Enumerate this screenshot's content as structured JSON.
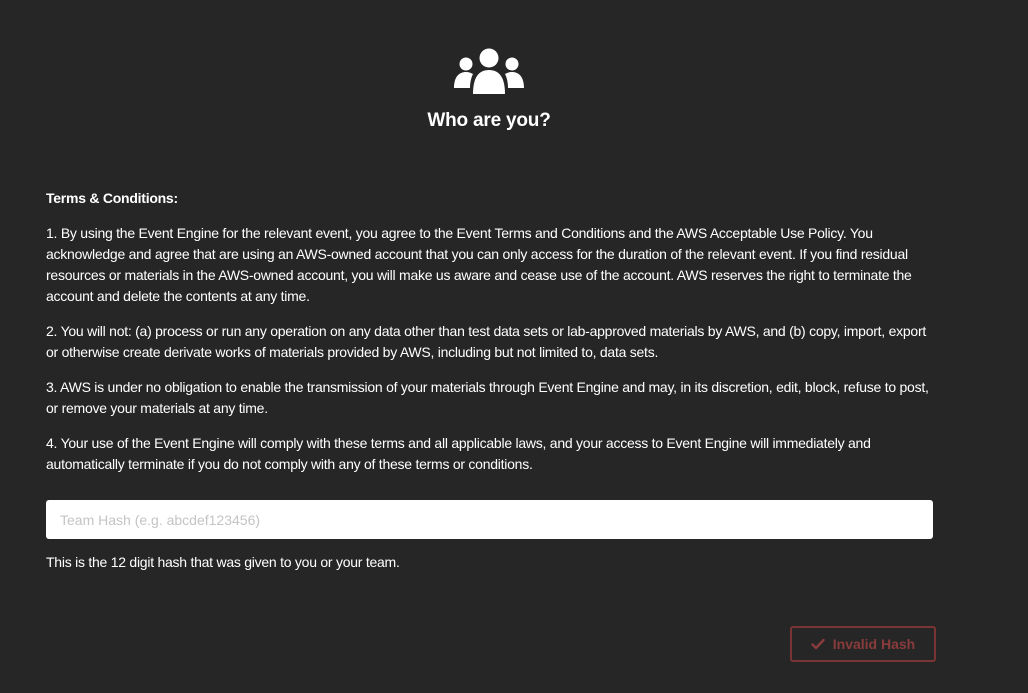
{
  "header": {
    "icon": "users-icon",
    "title": "Who are you?"
  },
  "terms": {
    "heading": "Terms & Conditions:",
    "items": [
      "1. By using the Event Engine for the relevant event, you agree to the Event Terms and Conditions and the AWS Acceptable Use Policy. You acknowledge and agree that are using an AWS-owned account that you can only access for the duration of the relevant event. If you find residual resources or materials in the AWS-owned account, you will make us aware and cease use of the account. AWS reserves the right to terminate the account and delete the contents at any time.",
      "2. You will not: (a) process or run any operation on any data other than test data sets or lab-approved materials by AWS, and (b) copy, import, export or otherwise create derivate works of materials provided by AWS, including but not limited to, data sets.",
      "3. AWS is under no obligation to enable the transmission of your materials through Event Engine and may, in its discretion, edit, block, refuse to post, or remove your materials at any time.",
      "4. Your use of the Event Engine will comply with these terms and all applicable laws, and your access to Event Engine will immediately and automatically terminate if you do not comply with any of these terms or conditions."
    ]
  },
  "hash_input": {
    "value": "",
    "placeholder": "Team Hash (e.g. abcdef123456)",
    "help_text": "This is the 12 digit hash that was given to you or your team."
  },
  "submit": {
    "icon": "check-icon",
    "label": "Invalid Hash",
    "state_color": "#8a3b3b"
  },
  "colors": {
    "background": "#262626",
    "text": "#ffffff"
  }
}
